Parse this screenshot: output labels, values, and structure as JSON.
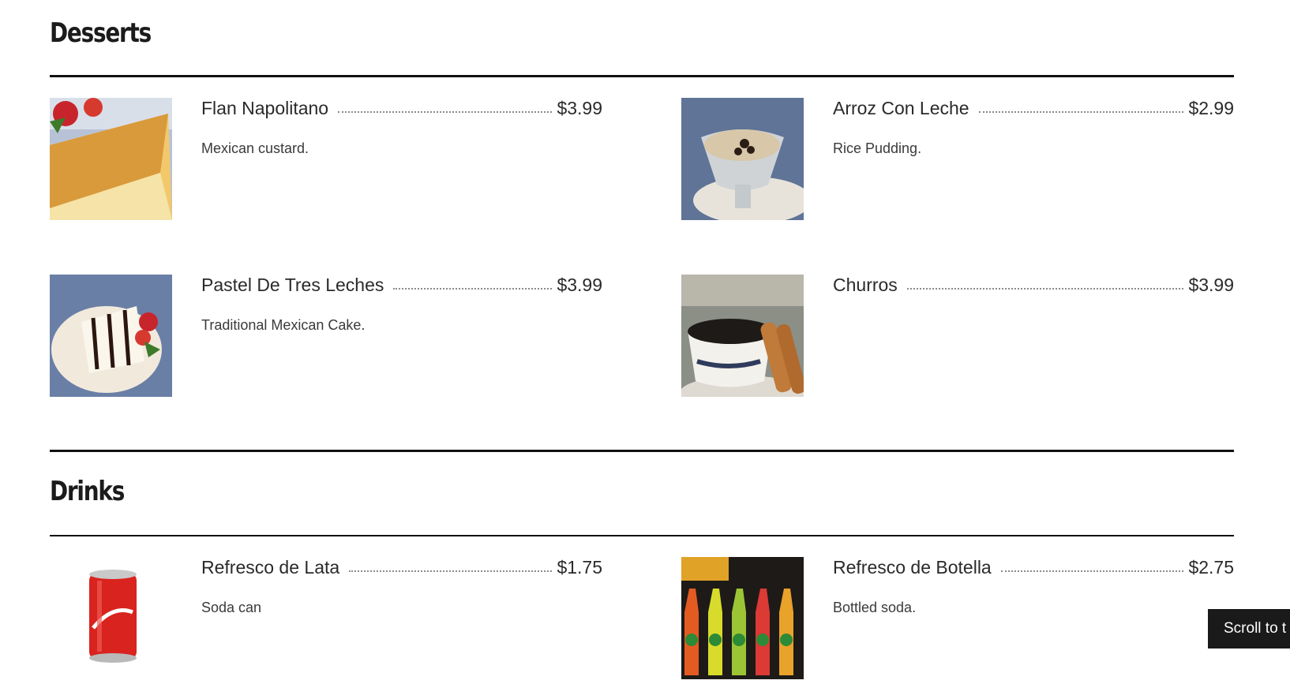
{
  "sections": {
    "desserts": {
      "title": "Desserts",
      "items": [
        {
          "name": "Flan Napolitano",
          "price": "$3.99",
          "description": "Mexican custard.",
          "image": "flan-image"
        },
        {
          "name": "Arroz Con Leche",
          "price": "$2.99",
          "description": "Rice Pudding.",
          "image": "rice-pudding-image"
        },
        {
          "name": "Pastel De Tres Leches",
          "price": "$3.99",
          "description": "Traditional Mexican Cake.",
          "image": "tres-leches-image"
        },
        {
          "name": "Churros",
          "price": "$3.99",
          "description": "",
          "image": "churros-coffee-image"
        }
      ]
    },
    "drinks": {
      "title": "Drinks",
      "items": [
        {
          "name": "Refresco de Lata",
          "price": "$1.75",
          "description": "Soda can",
          "image": "soda-can-image"
        },
        {
          "name": "Refresco de Botella",
          "price": "$2.75",
          "description": "Bottled soda.",
          "image": "bottled-soda-image"
        }
      ]
    }
  },
  "scroll_button": {
    "label": "Scroll to t"
  },
  "colors": {
    "text": "#1f1f1f",
    "rule": "#111111",
    "button_bg": "#1a1a1a"
  }
}
